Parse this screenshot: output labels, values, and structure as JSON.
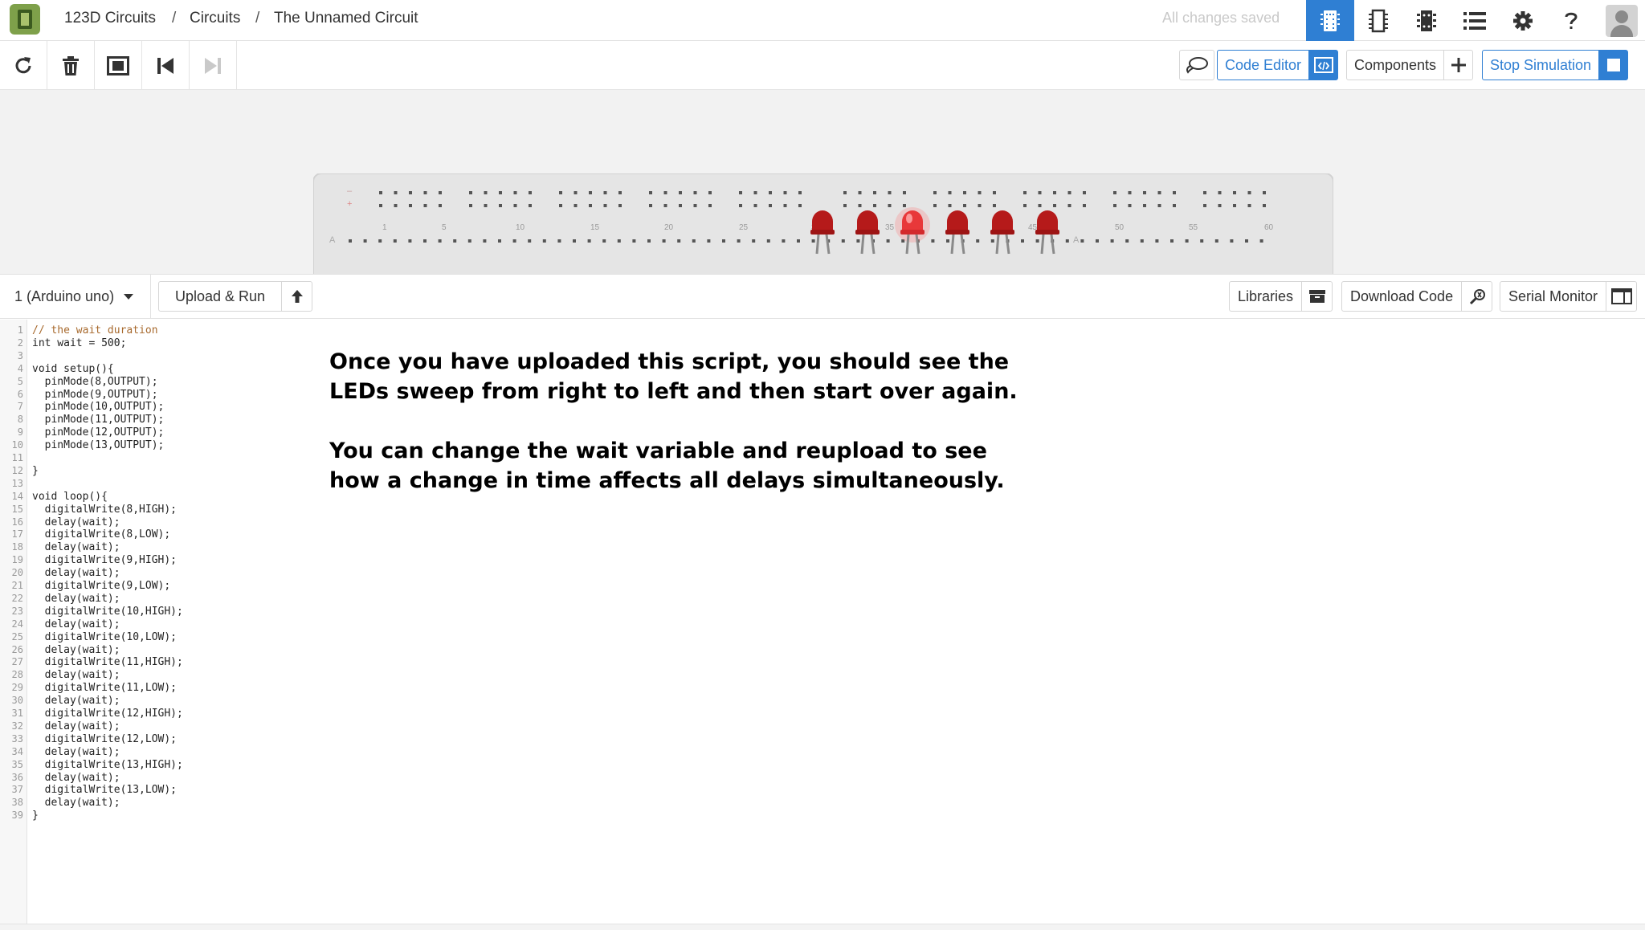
{
  "breadcrumbs": [
    "123D Circuits",
    "Circuits",
    "The Unnamed Circuit"
  ],
  "breadcrumb_separator": "/",
  "save_status": "All changes saved",
  "nav_icons": [
    "breadboard-view-icon",
    "schematic-view-icon",
    "pcb-view-icon",
    "component-list-icon",
    "settings-gear-icon",
    "help-icon"
  ],
  "toolbar": {
    "tools": [
      "rotate-icon",
      "trash-icon",
      "fit-view-icon",
      "step-back-icon",
      "step-forward-icon"
    ],
    "comment_icon": "comment-bubble-icon",
    "code_editor_label": "Code Editor",
    "components_label": "Components",
    "stop_simulation_label": "Stop Simulation"
  },
  "breadboard": {
    "column_labels": [
      "1",
      "5",
      "10",
      "15",
      "20",
      "25",
      "30",
      "35",
      "40",
      "45",
      "50",
      "55",
      "60"
    ],
    "row_marks": [
      "+",
      "A"
    ],
    "leds_lit": [
      false,
      false,
      true,
      false,
      false,
      false
    ],
    "led_color": "#b51a1a",
    "led_lit_color": "#e8383a"
  },
  "editor_header": {
    "board_select_value": "1 (Arduino uno)",
    "upload_label": "Upload & Run",
    "libraries_label": "Libraries",
    "download_label": "Download Code",
    "serial_monitor_label": "Serial Monitor"
  },
  "code": {
    "lines": [
      "// the wait duration",
      "int wait = 500;",
      "",
      "void setup(){",
      "  pinMode(8,OUTPUT);",
      "  pinMode(9,OUTPUT);",
      "  pinMode(10,OUTPUT);",
      "  pinMode(11,OUTPUT);",
      "  pinMode(12,OUTPUT);",
      "  pinMode(13,OUTPUT);",
      "",
      "}",
      "",
      "void loop(){",
      "  digitalWrite(8,HIGH);",
      "  delay(wait);",
      "  digitalWrite(8,LOW);",
      "  delay(wait);",
      "  digitalWrite(9,HIGH);",
      "  delay(wait);",
      "  digitalWrite(9,LOW);",
      "  delay(wait);",
      "  digitalWrite(10,HIGH);",
      "  delay(wait);",
      "  digitalWrite(10,LOW);",
      "  delay(wait);",
      "  digitalWrite(11,HIGH);",
      "  delay(wait);",
      "  digitalWrite(11,LOW);",
      "  delay(wait);",
      "  digitalWrite(12,HIGH);",
      "  delay(wait);",
      "  digitalWrite(12,LOW);",
      "  delay(wait);",
      "  digitalWrite(13,HIGH);",
      "  delay(wait);",
      "  digitalWrite(13,LOW);",
      "  delay(wait);",
      "}"
    ]
  },
  "annotation": {
    "line1": "Once you have uploaded this script, you should see the",
    "line2": "LEDs sweep from right to left and then start over again.",
    "line3": "You can change the wait variable and reupload to see",
    "line4": "how a change in time affects all delays simultaneously."
  },
  "colors": {
    "accent": "#2f7fd3",
    "logo_green": "#7ea04a",
    "comment": "#a86a2e"
  }
}
